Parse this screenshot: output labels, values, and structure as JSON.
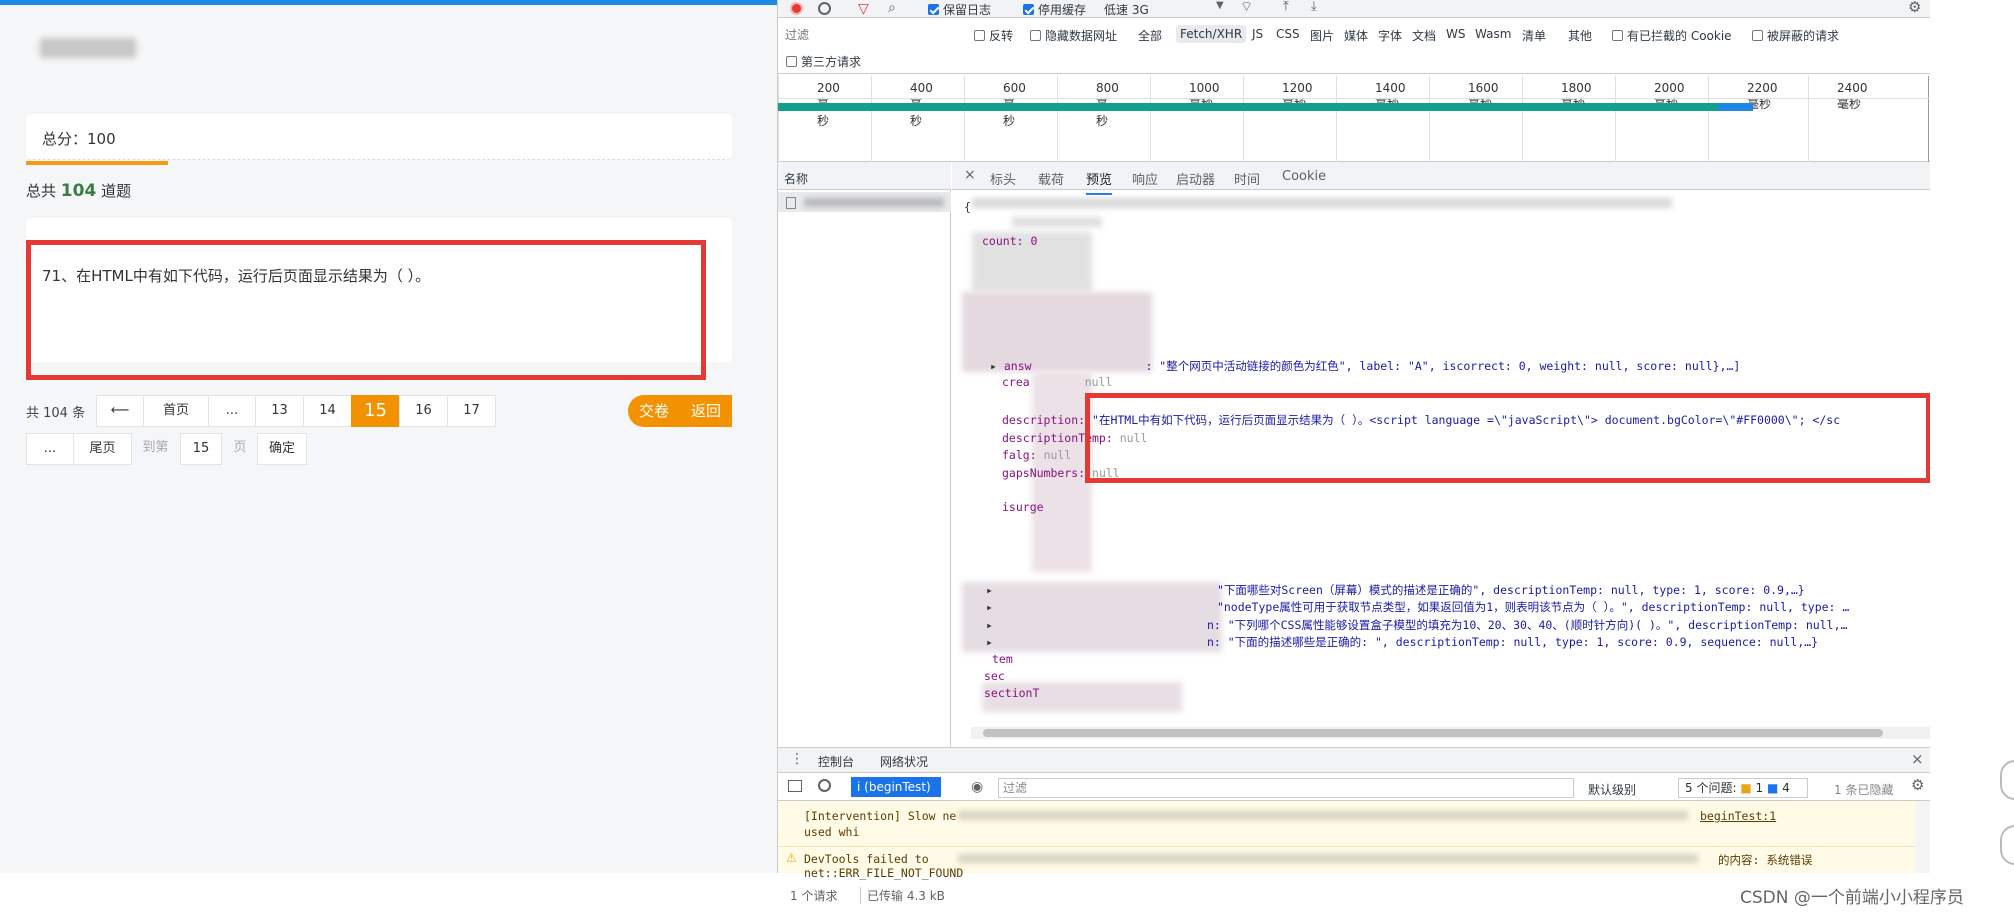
{
  "exam": {
    "score_label": "总分：100",
    "total_prefix": "总共",
    "total_count": "104",
    "total_suffix": "道题",
    "question_text": "71、在HTML中有如下代码，运行后页面显示结果为（ ）。"
  },
  "pagination": {
    "total_label": "共 104 条",
    "prev": "⟵",
    "first": "首页",
    "ellipsis": "...",
    "pages": [
      "13",
      "14",
      "15",
      "16",
      "17"
    ],
    "current": "15",
    "last": "尾页",
    "goto_label": "到第",
    "goto_value": "15",
    "page_unit": "页",
    "confirm": "确定",
    "submit": "交卷",
    "back": "返回"
  },
  "devtools": {
    "toolbar": {
      "preserve_log": "保留日志",
      "disable_cache": "停用缓存",
      "throttle": "低速 3G"
    },
    "filter": {
      "placeholder": "过滤",
      "invert": "反转",
      "hide_data_urls": "隐藏数据网址",
      "types": [
        "全部",
        "Fetch/XHR",
        "JS",
        "CSS",
        "图片",
        "媒体",
        "字体",
        "文档",
        "WS",
        "Wasm",
        "清单",
        "其他"
      ],
      "blocked_cookies": "有已拦截的 Cookie",
      "blocked_requests": "被屏蔽的请求",
      "third_party": "第三方请求"
    },
    "timeline_ticks": [
      "200 毫秒",
      "400 毫秒",
      "600 毫秒",
      "800 毫秒",
      "1000 毫秒",
      "1200 毫秒",
      "1400 毫秒",
      "1600 毫秒",
      "1800 毫秒",
      "2000 毫秒",
      "2200 毫秒",
      "2400 毫秒"
    ],
    "name_header": "名称",
    "preview_tabs": [
      "标头",
      "载荷",
      "预览",
      "响应",
      "启动器",
      "时间",
      "Cookie"
    ],
    "selected_tab": "预览",
    "code": {
      "line_count": "count: 0",
      "answer_line_key": "answ",
      "answer_line_val": ": \"整个网页中活动链接的颜色为红色\", label: \"A\", iscorrect: 0, weight: null, score: null},…]",
      "creatime_key": "crea",
      "creatime_val": "null",
      "desc_key": "description:",
      "desc_val": "\"在HTML中有如下代码，运行后页面显示结果为（    ）。<script language =\\\"javaScript\\\"> document.bgColor=\\\"#FF0000\\\"; </sc",
      "desctemp_key": "descriptionTemp:",
      "desctemp_val": "null",
      "falg_key": "falg:",
      "falg_val": "null",
      "gaps_key": "gapsNumbers:",
      "gaps_val": "null",
      "isurge_key": "isurge",
      "r1": "\"下面哪些对Screen（屏幕）模式的描述是正确的\", descriptionTemp: null, type: 1, score: 0.9,…}",
      "r2": "\"nodeType属性可用于获取节点类型，如果返回值为1，则表明该节点为（ ）。\", descriptionTemp: null, type: …",
      "r3": "n: \"下列哪个CSS属性能够设置盒子模型的填充为10、20、30、40、(顺时针方向)( )。\", descriptionTemp: null,…",
      "r4": "n: \"下面的描述哪些是正确的: \", descriptionTemp: null, type: 1, score: 0.9, sequence: null,…}",
      "temp_key": "tem",
      "sec_key": "sec",
      "sectionT_key": "sectionT"
    },
    "status": {
      "requests": "1 个请求",
      "transferred": "已传输 4.3 kB"
    },
    "console": {
      "tabs": [
        "控制台",
        "网络状况"
      ],
      "context": "i (beginTest)",
      "filter_placeholder": "过滤",
      "level": "默认级别",
      "issues_label": "5 个问题:",
      "issues_warn": "1",
      "issues_info": "4",
      "hidden": "1 条已隐藏",
      "line1": "[Intervention] Slow ne",
      "line1_right": "beginTest:1",
      "line2": "used whi",
      "warn_line": "DevTools failed to ",
      "warn_right": "的内容: 系统错误",
      "err_line": "net::ERR_FILE_NOT_FOUND"
    }
  },
  "watermark": "CSDN @一个前端小小程序员",
  "colors": {
    "accent_orange": "#f39200",
    "highlight_red": "#e53935",
    "total_green": "#3a7d44",
    "devtools_blue": "#1a73e8"
  }
}
